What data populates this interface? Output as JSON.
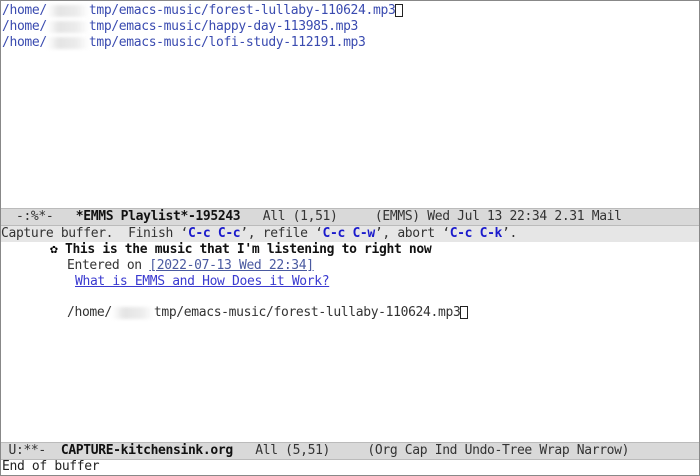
{
  "playlist": {
    "tracks": [
      {
        "prefix": "/home/",
        "path": "tmp/emacs-music/forest-lullaby-110624.mp3"
      },
      {
        "prefix": "/home/",
        "path": "tmp/emacs-music/happy-day-113985.mp3"
      },
      {
        "prefix": "/home/",
        "path": "tmp/emacs-music/lofi-study-112191.mp3"
      }
    ]
  },
  "modeline_top": {
    "status": "-:%*-",
    "buffer": "*EMMS Playlist*-195243",
    "position": "All (1,51)",
    "modes": "(EMMS) Wed Jul 13 22:34 2.31 Mail"
  },
  "capture_header": {
    "t1": "Capture buffer.  Finish ",
    "k1": "C-c C-c",
    "t2": ", refile ",
    "k2": "C-c C-w",
    "t3": ", abort ",
    "k3": "C-c C-k",
    "t4": "."
  },
  "capture": {
    "bullet": "✿",
    "heading": "This is the music that I'm listening to right now",
    "entered_label": "Entered on ",
    "timestamp": "[2022-07-13 Wed 22:34]",
    "link": "What is EMMS and How Does it Work?",
    "file_prefix": "/home/",
    "file_path": "tmp/emacs-music/forest-lullaby-110624.mp3"
  },
  "modeline_bottom": {
    "status": "U:**-",
    "buffer": "CAPTURE-kitchensink.org",
    "position": "All (5,51)",
    "modes": "(Org Cap Ind Undo-Tree Wrap Narrow)"
  },
  "minibuffer": {
    "message": "End of buffer"
  }
}
